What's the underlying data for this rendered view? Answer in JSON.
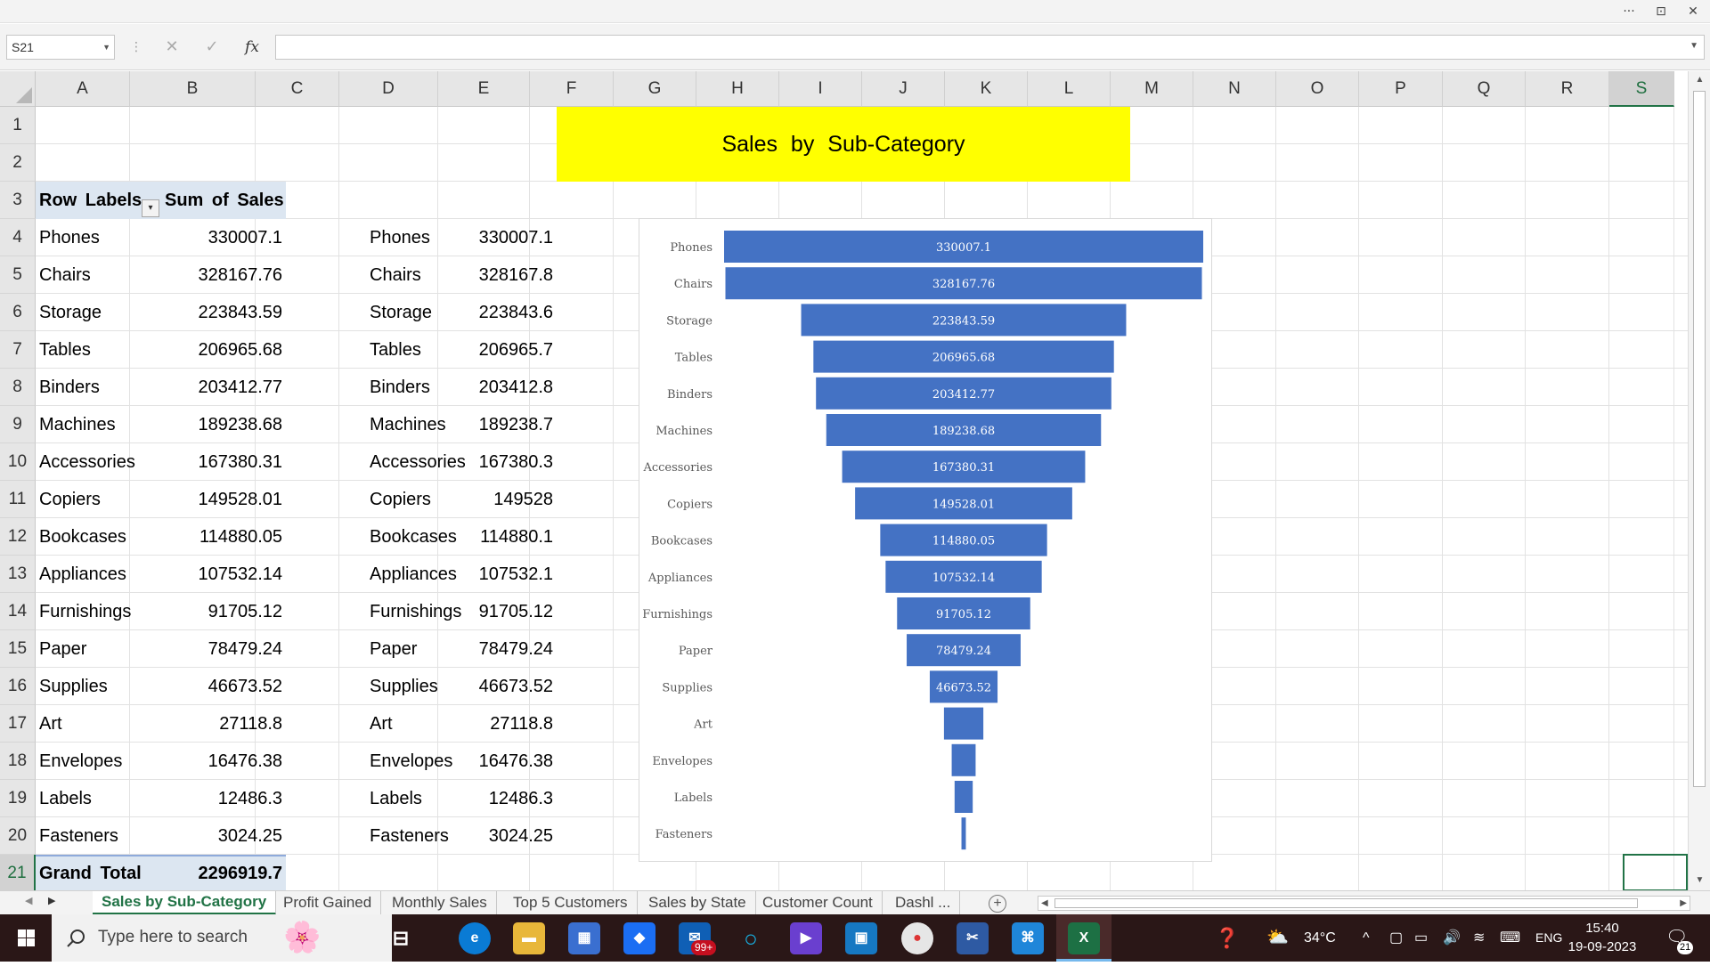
{
  "window": {
    "controls": [
      "···",
      "⊡",
      "✕"
    ]
  },
  "formula_bar": {
    "name_box": "S21",
    "formula_value": ""
  },
  "columns": [
    "A",
    "B",
    "C",
    "D",
    "E",
    "F",
    "G",
    "H",
    "I",
    "J",
    "K",
    "L",
    "M",
    "N",
    "O",
    "P",
    "Q",
    "R",
    "S"
  ],
  "rows": [
    "1",
    "2",
    "3",
    "4",
    "5",
    "6",
    "7",
    "8",
    "9",
    "10",
    "11",
    "12",
    "13",
    "14",
    "15",
    "16",
    "17",
    "18",
    "19",
    "20",
    "21"
  ],
  "selected_cell": {
    "column": "S",
    "row": "21"
  },
  "banner_title": "Sales by Sub-Category",
  "pivot": {
    "header_label": "Row Labels",
    "header_value": "Sum of Sales",
    "rows": [
      {
        "label": "Phones",
        "value": "330007.1"
      },
      {
        "label": "Chairs",
        "value": "328167.76"
      },
      {
        "label": "Storage",
        "value": "223843.59"
      },
      {
        "label": "Tables",
        "value": "206965.68"
      },
      {
        "label": "Binders",
        "value": "203412.77"
      },
      {
        "label": "Machines",
        "value": "189238.68"
      },
      {
        "label": "Accessories",
        "value": "167380.31"
      },
      {
        "label": "Copiers",
        "value": "149528.01"
      },
      {
        "label": "Bookcases",
        "value": "114880.05"
      },
      {
        "label": "Appliances",
        "value": "107532.14"
      },
      {
        "label": "Furnishings",
        "value": "91705.12"
      },
      {
        "label": "Paper",
        "value": "78479.24"
      },
      {
        "label": "Supplies",
        "value": "46673.52"
      },
      {
        "label": "Art",
        "value": "27118.8"
      },
      {
        "label": "Envelopes",
        "value": "16476.38"
      },
      {
        "label": "Labels",
        "value": "12486.3"
      },
      {
        "label": "Fasteners",
        "value": "3024.25"
      }
    ],
    "total_label": "Grand Total",
    "total_value": "2296919.7"
  },
  "copy_table": [
    {
      "label": "Phones",
      "value": "330007.1"
    },
    {
      "label": "Chairs",
      "value": "328167.8"
    },
    {
      "label": "Storage",
      "value": "223843.6"
    },
    {
      "label": "Tables",
      "value": "206965.7"
    },
    {
      "label": "Binders",
      "value": "203412.8"
    },
    {
      "label": "Machines",
      "value": "189238.7"
    },
    {
      "label": "Accessories",
      "value": "167380.3"
    },
    {
      "label": "Copiers",
      "value": "149528"
    },
    {
      "label": "Bookcases",
      "value": "114880.1"
    },
    {
      "label": "Appliances",
      "value": "107532.1"
    },
    {
      "label": "Furnishings",
      "value": "91705.12"
    },
    {
      "label": "Paper",
      "value": "78479.24"
    },
    {
      "label": "Supplies",
      "value": "46673.52"
    },
    {
      "label": "Art",
      "value": "27118.8"
    },
    {
      "label": "Envelopes",
      "value": "16476.38"
    },
    {
      "label": "Labels",
      "value": "12486.3"
    },
    {
      "label": "Fasteners",
      "value": "3024.25"
    }
  ],
  "chart_data": {
    "type": "bar",
    "orientation": "funnel",
    "categories": [
      "Phones",
      "Chairs",
      "Storage",
      "Tables",
      "Binders",
      "Machines",
      "Accessories",
      "Copiers",
      "Bookcases",
      "Appliances",
      "Furnishings",
      "Paper",
      "Supplies",
      "Art",
      "Envelopes",
      "Labels",
      "Fasteners"
    ],
    "values": [
      330007.1,
      328167.76,
      223843.59,
      206965.68,
      203412.77,
      189238.68,
      167380.31,
      149528.01,
      114880.05,
      107532.14,
      91705.12,
      78479.24,
      46673.52,
      27118.8,
      16476.38,
      12486.3,
      3024.25
    ],
    "data_labels": [
      "330007.1",
      "328167.76",
      "223843.59",
      "206965.68",
      "203412.77",
      "189238.68",
      "167380.31",
      "149528.01",
      "114880.05",
      "107532.14",
      "91705.12",
      "78479.24",
      "46673.52",
      "",
      "",
      "",
      ""
    ],
    "bar_color": "#4472c4",
    "label_color": "#ffffff",
    "title": ""
  },
  "sheet_tabs": {
    "tabs": [
      "Sales by Sub-Category",
      "Profit Gained",
      "Monthly Sales",
      "Top 5 Customers",
      "Sales by State",
      "Customer Count",
      "Dashl ..."
    ],
    "active_index": 0
  },
  "taskbar": {
    "search_placeholder": "Type here to search",
    "mail_badge": "99+",
    "weather": "34°C",
    "language": "ENG",
    "time": "15:40",
    "date": "19-09-2023",
    "notification_count": "21"
  },
  "colors": {
    "excel_green": "#217346",
    "banner_yellow": "#ffff00",
    "pivot_header": "#dce6f1"
  }
}
